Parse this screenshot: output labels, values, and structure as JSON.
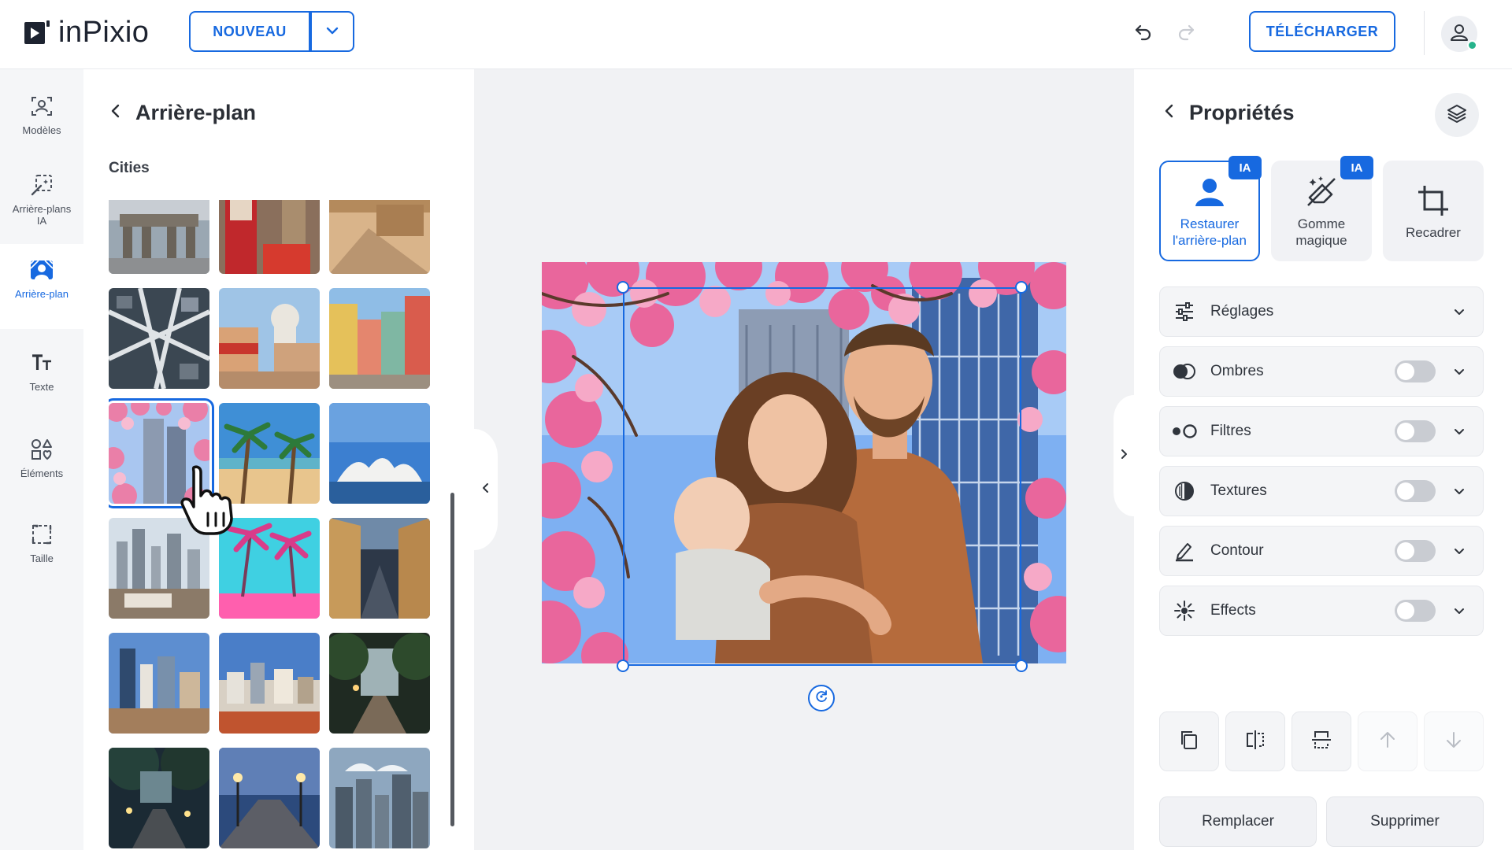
{
  "app": {
    "logo_text": "inPixio"
  },
  "topbar": {
    "new_label": "NOUVEAU",
    "download_label": "TÉLÉCHARGER"
  },
  "rail": {
    "items": [
      {
        "label": "Modèles",
        "icon": "templates-icon"
      },
      {
        "label": "Arrière-plans IA",
        "icon": "ai-backgrounds-icon"
      },
      {
        "label": "Arrière-plan",
        "icon": "background-icon",
        "active": true
      },
      {
        "label": "Texte",
        "icon": "text-icon"
      },
      {
        "label": "Éléments",
        "icon": "elements-icon"
      },
      {
        "label": "Taille",
        "icon": "size-icon"
      }
    ]
  },
  "panel": {
    "title": "Arrière-plan",
    "section": "Cities"
  },
  "props": {
    "title": "Propriétés",
    "tools": [
      {
        "label": "Restaurer l'arrière-plan",
        "badge": "IA",
        "active": true
      },
      {
        "label": "Gomme magique",
        "badge": "IA"
      },
      {
        "label": "Recadrer"
      }
    ],
    "sections": [
      {
        "label": "Réglages",
        "has_toggle": false
      },
      {
        "label": "Ombres",
        "has_toggle": true,
        "on": false
      },
      {
        "label": "Filtres",
        "has_toggle": true,
        "on": false
      },
      {
        "label": "Textures",
        "has_toggle": true,
        "on": false
      },
      {
        "label": "Contour",
        "has_toggle": true,
        "on": false
      },
      {
        "label": "Effects",
        "has_toggle": true,
        "on": false
      }
    ],
    "replace_label": "Remplacer",
    "delete_label": "Supprimer"
  },
  "colors": {
    "accent": "#1769e0",
    "toggle_off": "#c9ccd2"
  }
}
